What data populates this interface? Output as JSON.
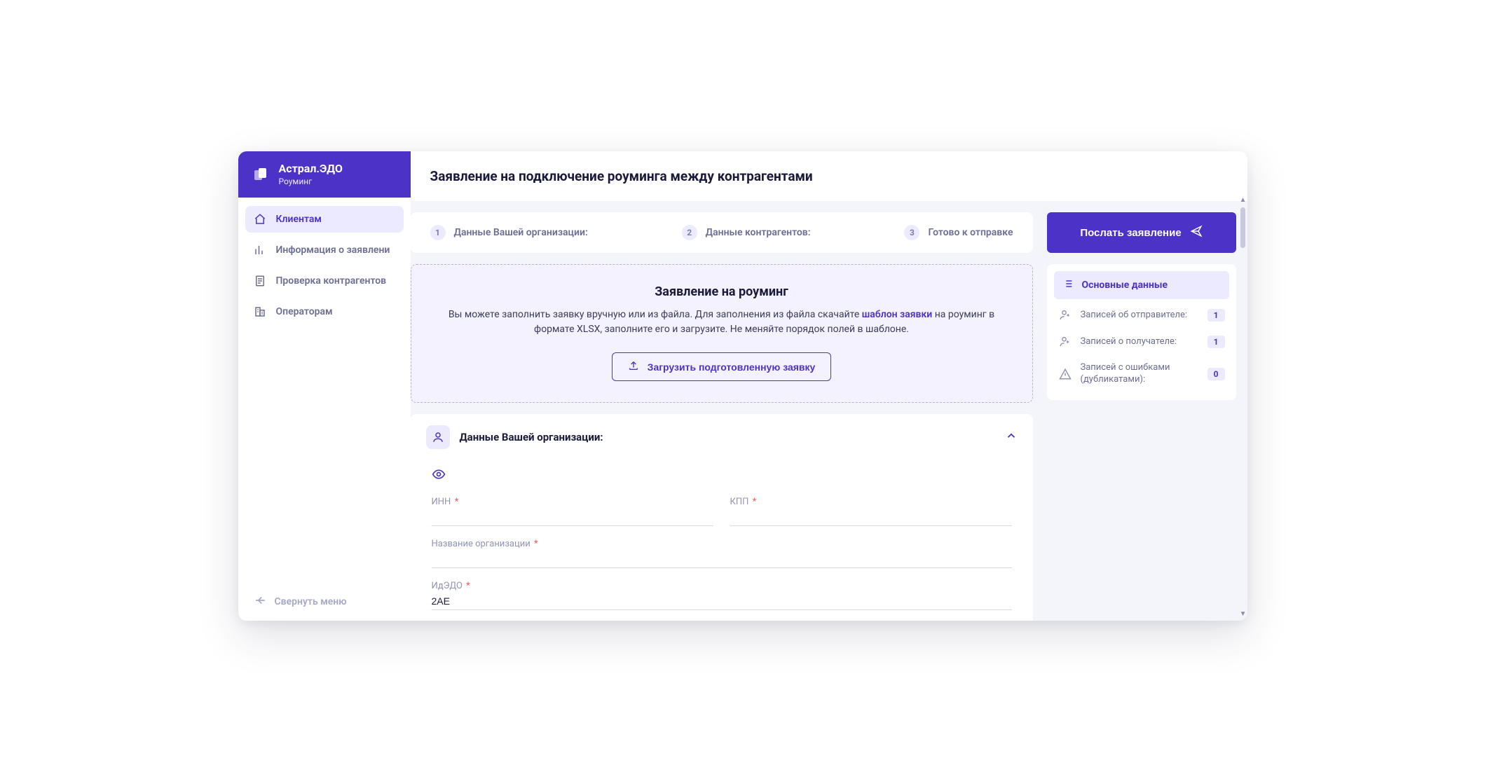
{
  "brand": {
    "title": "Астрал.ЭДО",
    "subtitle": "Роуминг"
  },
  "nav": {
    "items": [
      {
        "label": "Клиентам"
      },
      {
        "label": "Информация о заявлени"
      },
      {
        "label": "Проверка контрагентов"
      },
      {
        "label": "Операторам"
      }
    ],
    "collapse": "Свернуть меню"
  },
  "page": {
    "title": "Заявление на подключение роуминга между контрагентами"
  },
  "steps": [
    {
      "num": "1",
      "label": "Данные Вашей организации:"
    },
    {
      "num": "2",
      "label": "Данные контрагентов:"
    },
    {
      "num": "3",
      "label": "Готово к отправке"
    }
  ],
  "intro": {
    "title": "Заявление на роуминг",
    "text_before": "Вы можете заполнить заявку вручную или из файла. Для заполнения из файла скачайте ",
    "link": "шаблон заявки",
    "text_after": " на роуминг в формате XLSX, заполните его и загрузите. Не меняйте порядок полей в шаблоне.",
    "upload": "Загрузить подготовленную заявку"
  },
  "org": {
    "title": "Данные Вашей организации:",
    "fields": {
      "inn": {
        "label": "ИНН",
        "value": ""
      },
      "kpp": {
        "label": "КПП",
        "value": ""
      },
      "name": {
        "label": "Название организации",
        "value": ""
      },
      "idedo": {
        "label": "ИдЭДО",
        "value": "2AE"
      }
    }
  },
  "submit": {
    "label": "Послать заявление"
  },
  "summary": {
    "title": "Основные данные",
    "rows": [
      {
        "label": "Записей об отправителе:",
        "value": "1"
      },
      {
        "label": "Записей о получателе:",
        "value": "1"
      },
      {
        "label": "Записей с ошибками (дубликатами):",
        "value": "0"
      }
    ]
  }
}
